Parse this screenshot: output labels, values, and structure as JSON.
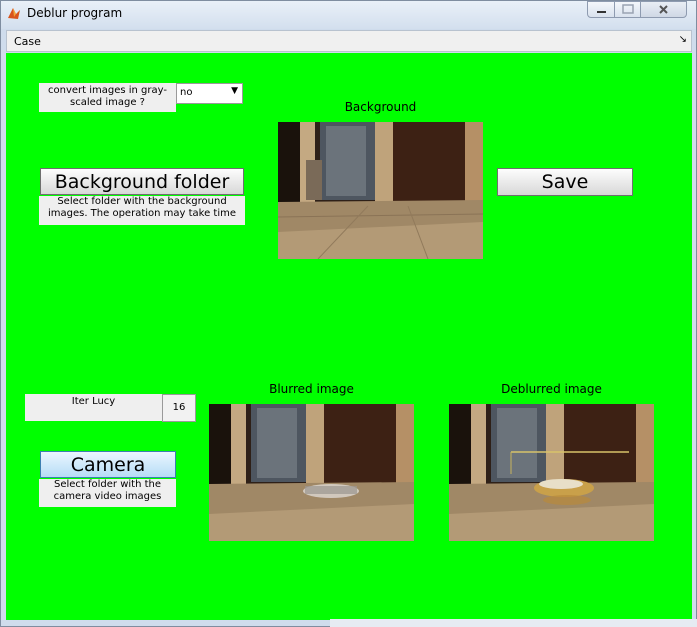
{
  "window": {
    "title": "Deblur program"
  },
  "menu": {
    "case": "Case"
  },
  "controls": {
    "gray_question": "convert images in gray-scaled image ?",
    "gray_value": "no",
    "background_folder_button": "Background folder",
    "background_folder_help": "Select folder with the background images. The operation may take time",
    "save_button": "Save",
    "iter_lucy_label": "Iter Lucy",
    "iter_lucy_value": "16",
    "camera_button": "Camera",
    "camera_help": "Select folder with the camera video images"
  },
  "captions": {
    "background": "Background",
    "blurred": "Blurred image",
    "deblurred": "Deblurred image"
  },
  "colors": {
    "panel_green": "#00ff00"
  },
  "icons": {
    "app": "matlab-icon",
    "minimize": "minimize-icon",
    "maximize": "maximize-icon",
    "close": "close-icon",
    "dropdown": "chevron-down-icon"
  }
}
